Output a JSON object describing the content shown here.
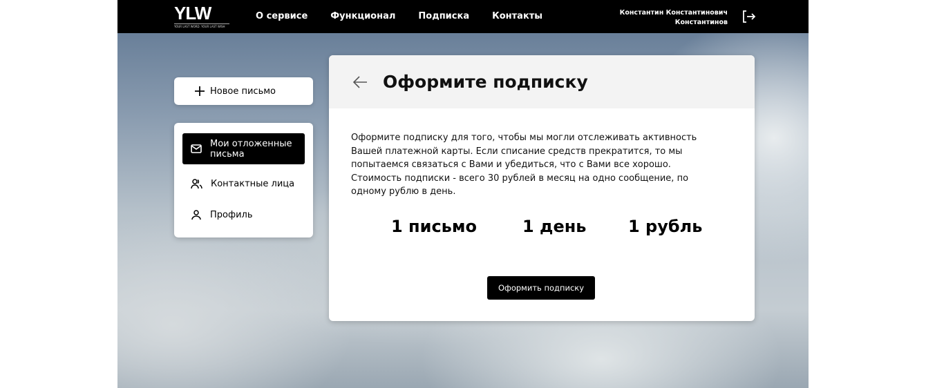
{
  "header": {
    "logo_text": "YLW",
    "logo_tagline": "YOUR LAST WORD. YOUR LAST WISH",
    "nav": [
      "О сервисе",
      "Функционал",
      "Подписка",
      "Контакты"
    ],
    "user_line1": "Константин Константинович",
    "user_line2": "Константинов"
  },
  "sidebar": {
    "new_letter": "Новое письмо",
    "items": [
      {
        "label": "Мои отложенные письма",
        "icon": "mail-icon"
      },
      {
        "label": "Контактные лица",
        "icon": "users-icon"
      },
      {
        "label": "Профиль",
        "icon": "user-icon"
      }
    ]
  },
  "main": {
    "title": "Оформите подписку",
    "description": "Оформите подписку для того, чтобы мы могли отслеживать активность Вашей платежной карты. Если списание средств прекратится, то мы попытаемся связаться с Вами и убедиться, что с Вами все хорошо. Стоимость подписки - всего 30 рублей в месяц на одно сообщение, по одному рублю в день.",
    "stats": [
      "1 письмо",
      "1 день",
      "1 рубль"
    ],
    "subscribe_button": "Оформить подписку"
  }
}
